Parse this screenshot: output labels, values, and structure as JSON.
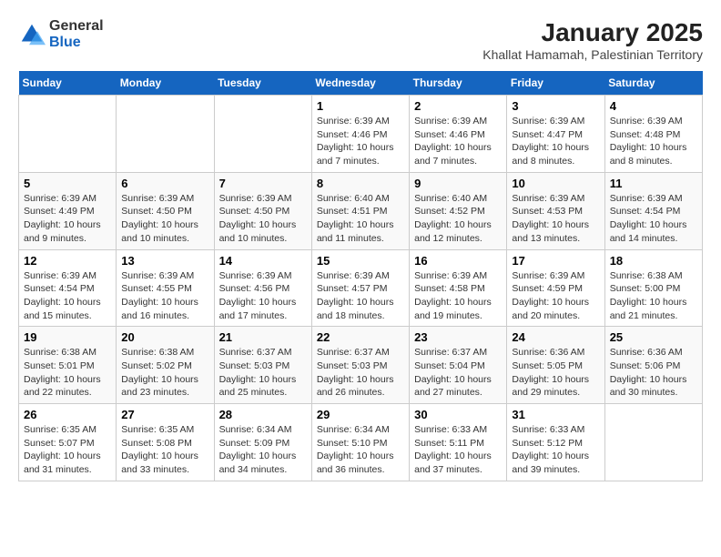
{
  "header": {
    "logo_general": "General",
    "logo_blue": "Blue",
    "title": "January 2025",
    "subtitle": "Khallat Hamamah, Palestinian Territory"
  },
  "days_of_week": [
    "Sunday",
    "Monday",
    "Tuesday",
    "Wednesday",
    "Thursday",
    "Friday",
    "Saturday"
  ],
  "weeks": [
    [
      {
        "day": "",
        "info": ""
      },
      {
        "day": "",
        "info": ""
      },
      {
        "day": "",
        "info": ""
      },
      {
        "day": "1",
        "info": "Sunrise: 6:39 AM\nSunset: 4:46 PM\nDaylight: 10 hours and 7 minutes."
      },
      {
        "day": "2",
        "info": "Sunrise: 6:39 AM\nSunset: 4:46 PM\nDaylight: 10 hours and 7 minutes."
      },
      {
        "day": "3",
        "info": "Sunrise: 6:39 AM\nSunset: 4:47 PM\nDaylight: 10 hours and 8 minutes."
      },
      {
        "day": "4",
        "info": "Sunrise: 6:39 AM\nSunset: 4:48 PM\nDaylight: 10 hours and 8 minutes."
      }
    ],
    [
      {
        "day": "5",
        "info": "Sunrise: 6:39 AM\nSunset: 4:49 PM\nDaylight: 10 hours and 9 minutes."
      },
      {
        "day": "6",
        "info": "Sunrise: 6:39 AM\nSunset: 4:50 PM\nDaylight: 10 hours and 10 minutes."
      },
      {
        "day": "7",
        "info": "Sunrise: 6:39 AM\nSunset: 4:50 PM\nDaylight: 10 hours and 10 minutes."
      },
      {
        "day": "8",
        "info": "Sunrise: 6:40 AM\nSunset: 4:51 PM\nDaylight: 10 hours and 11 minutes."
      },
      {
        "day": "9",
        "info": "Sunrise: 6:40 AM\nSunset: 4:52 PM\nDaylight: 10 hours and 12 minutes."
      },
      {
        "day": "10",
        "info": "Sunrise: 6:39 AM\nSunset: 4:53 PM\nDaylight: 10 hours and 13 minutes."
      },
      {
        "day": "11",
        "info": "Sunrise: 6:39 AM\nSunset: 4:54 PM\nDaylight: 10 hours and 14 minutes."
      }
    ],
    [
      {
        "day": "12",
        "info": "Sunrise: 6:39 AM\nSunset: 4:54 PM\nDaylight: 10 hours and 15 minutes."
      },
      {
        "day": "13",
        "info": "Sunrise: 6:39 AM\nSunset: 4:55 PM\nDaylight: 10 hours and 16 minutes."
      },
      {
        "day": "14",
        "info": "Sunrise: 6:39 AM\nSunset: 4:56 PM\nDaylight: 10 hours and 17 minutes."
      },
      {
        "day": "15",
        "info": "Sunrise: 6:39 AM\nSunset: 4:57 PM\nDaylight: 10 hours and 18 minutes."
      },
      {
        "day": "16",
        "info": "Sunrise: 6:39 AM\nSunset: 4:58 PM\nDaylight: 10 hours and 19 minutes."
      },
      {
        "day": "17",
        "info": "Sunrise: 6:39 AM\nSunset: 4:59 PM\nDaylight: 10 hours and 20 minutes."
      },
      {
        "day": "18",
        "info": "Sunrise: 6:38 AM\nSunset: 5:00 PM\nDaylight: 10 hours and 21 minutes."
      }
    ],
    [
      {
        "day": "19",
        "info": "Sunrise: 6:38 AM\nSunset: 5:01 PM\nDaylight: 10 hours and 22 minutes."
      },
      {
        "day": "20",
        "info": "Sunrise: 6:38 AM\nSunset: 5:02 PM\nDaylight: 10 hours and 23 minutes."
      },
      {
        "day": "21",
        "info": "Sunrise: 6:37 AM\nSunset: 5:03 PM\nDaylight: 10 hours and 25 minutes."
      },
      {
        "day": "22",
        "info": "Sunrise: 6:37 AM\nSunset: 5:03 PM\nDaylight: 10 hours and 26 minutes."
      },
      {
        "day": "23",
        "info": "Sunrise: 6:37 AM\nSunset: 5:04 PM\nDaylight: 10 hours and 27 minutes."
      },
      {
        "day": "24",
        "info": "Sunrise: 6:36 AM\nSunset: 5:05 PM\nDaylight: 10 hours and 29 minutes."
      },
      {
        "day": "25",
        "info": "Sunrise: 6:36 AM\nSunset: 5:06 PM\nDaylight: 10 hours and 30 minutes."
      }
    ],
    [
      {
        "day": "26",
        "info": "Sunrise: 6:35 AM\nSunset: 5:07 PM\nDaylight: 10 hours and 31 minutes."
      },
      {
        "day": "27",
        "info": "Sunrise: 6:35 AM\nSunset: 5:08 PM\nDaylight: 10 hours and 33 minutes."
      },
      {
        "day": "28",
        "info": "Sunrise: 6:34 AM\nSunset: 5:09 PM\nDaylight: 10 hours and 34 minutes."
      },
      {
        "day": "29",
        "info": "Sunrise: 6:34 AM\nSunset: 5:10 PM\nDaylight: 10 hours and 36 minutes."
      },
      {
        "day": "30",
        "info": "Sunrise: 6:33 AM\nSunset: 5:11 PM\nDaylight: 10 hours and 37 minutes."
      },
      {
        "day": "31",
        "info": "Sunrise: 6:33 AM\nSunset: 5:12 PM\nDaylight: 10 hours and 39 minutes."
      },
      {
        "day": "",
        "info": ""
      }
    ]
  ]
}
